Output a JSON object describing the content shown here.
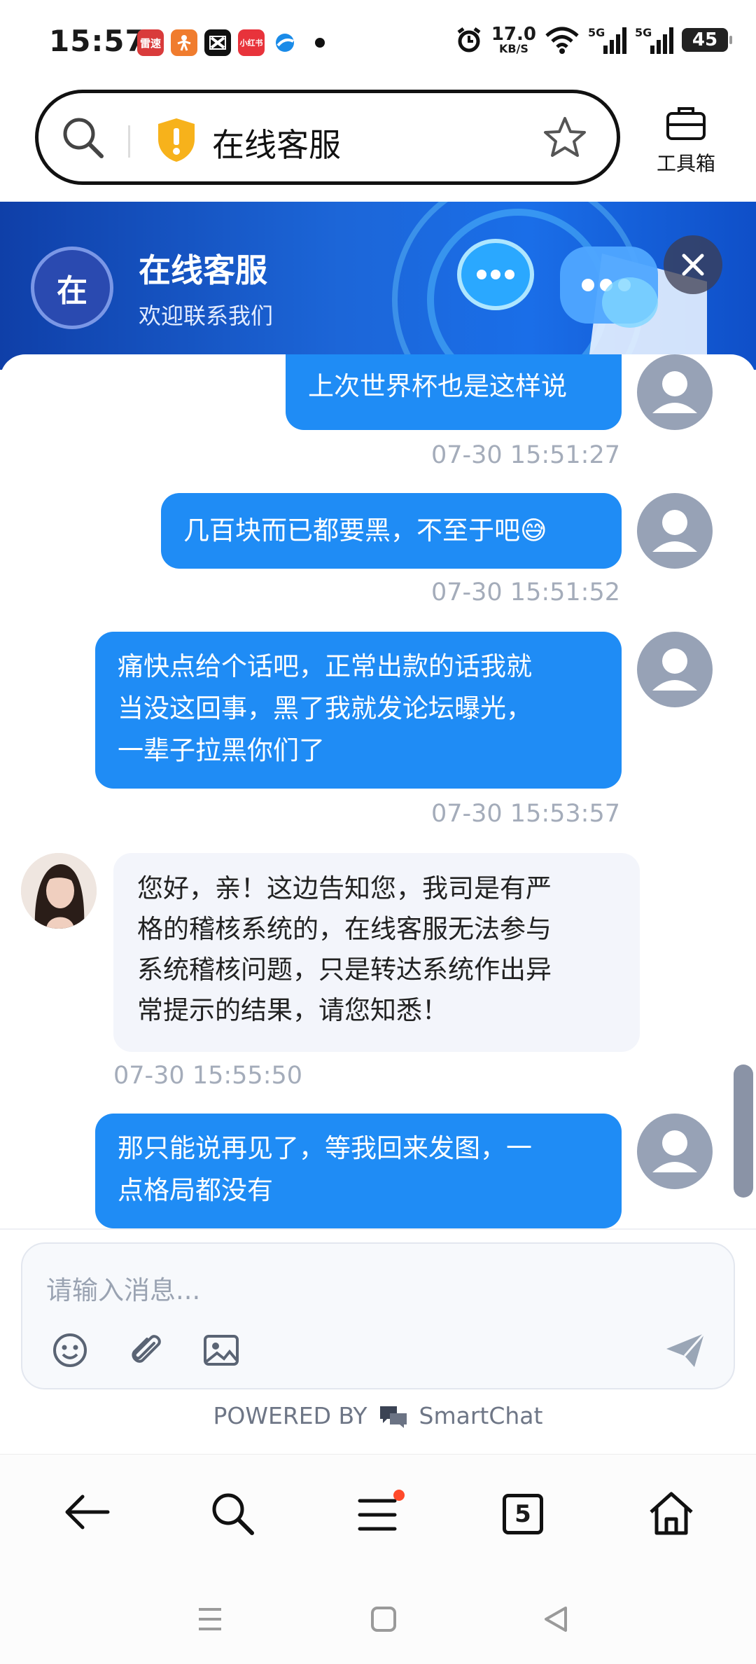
{
  "status_bar": {
    "time": "15:57",
    "app_icons": [
      {
        "name": "leisu-app-icon",
        "label": "雷速",
        "color": "#d93b3b"
      },
      {
        "name": "fitness-app-icon",
        "label": "",
        "color": "#f07c2e"
      },
      {
        "name": "capcut-app-icon",
        "label": "",
        "color": "#111111"
      },
      {
        "name": "xiaohongshu-app-icon",
        "label": "小红书",
        "color": "#e8333b"
      },
      {
        "name": "browser-app-icon",
        "label": "",
        "color": "#1a8be8"
      }
    ],
    "net_speed": "17.0",
    "net_unit": "KB/S",
    "signal1": "5G",
    "signal2": "5G",
    "battery": "45"
  },
  "browser": {
    "address_title": "在线客服",
    "toolbox_label": "工具箱"
  },
  "banner": {
    "avatar_char": "在",
    "title": "在线客服",
    "subtitle": "欢迎联系我们"
  },
  "messages": [
    {
      "from": "me",
      "lines": [
        "上次世界杯也是这样说"
      ],
      "time": "07-30 15:51:27"
    },
    {
      "from": "me",
      "lines": [
        "几百块而已都要黑，不至于吧😅"
      ],
      "time": "07-30 15:51:52"
    },
    {
      "from": "me",
      "lines": [
        "痛快点给个话吧，正常出款的话我就",
        "当没这回事，黑了我就发论坛曝光，",
        "一辈子拉黑你们了"
      ],
      "time": "07-30 15:53:57"
    },
    {
      "from": "agent",
      "lines": [
        "您好，亲！这边告知您，我司是有严",
        "格的稽核系统的，在线客服无法参与",
        "系统稽核问题，只是转达系统作出异",
        "常提示的结果，请您知悉！"
      ],
      "time": "07-30 15:55:50"
    },
    {
      "from": "me",
      "lines": [
        "那只能说再见了，等我回来发图，一",
        "点格局都没有"
      ],
      "time": ""
    }
  ],
  "input": {
    "placeholder": "请输入消息..."
  },
  "powered": {
    "prefix": "POWERED BY",
    "brand": "SmartChat"
  },
  "nav": {
    "tab_count": "5"
  },
  "colors": {
    "user_bubble": "#1f8cf5",
    "agent_bubble": "#f3f5fb",
    "notification_dot": "#ff4a2a"
  }
}
